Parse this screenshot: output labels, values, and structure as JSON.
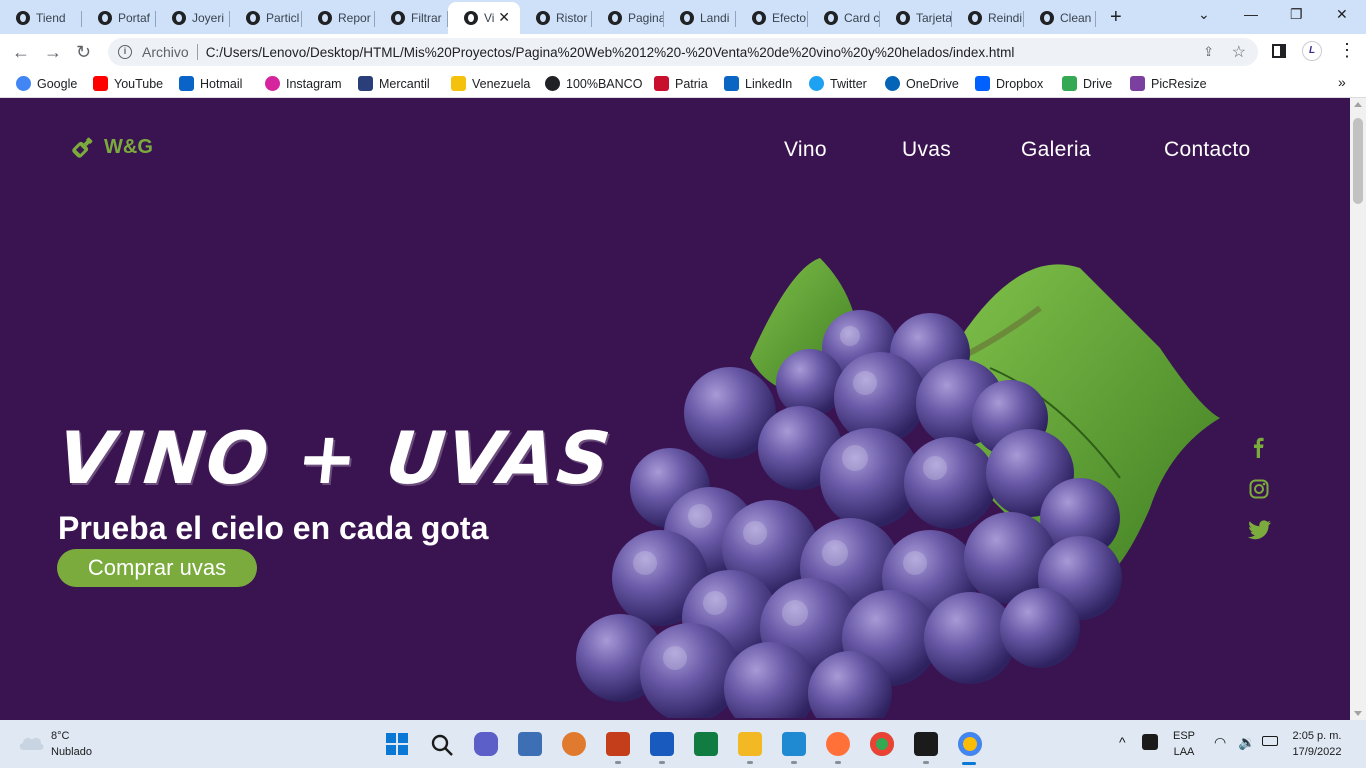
{
  "browser": {
    "tabs": [
      {
        "label": "Tiend"
      },
      {
        "label": "Portaf"
      },
      {
        "label": "Joyeri"
      },
      {
        "label": "Particl"
      },
      {
        "label": "Repor"
      },
      {
        "label": "Filtrar"
      },
      {
        "label": "Vi"
      },
      {
        "label": "Ristor"
      },
      {
        "label": "Pagina"
      },
      {
        "label": "Landi"
      },
      {
        "label": "Efecto"
      },
      {
        "label": "Card c"
      },
      {
        "label": "Tarjeta"
      },
      {
        "label": "Reindi"
      },
      {
        "label": "Clean"
      }
    ],
    "active_tab_index": 6,
    "address": {
      "scheme_label": "Archivo",
      "url": "C:/Users/Lenovo/Desktop/HTML/Mis%20Proyectos/Pagina%20Web%2012%20-%20Venta%20de%20vino%20y%20helados/index.html"
    },
    "bookmarks": [
      {
        "label": "Google",
        "color": "#4285f4"
      },
      {
        "label": "YouTube",
        "color": "#ff0000"
      },
      {
        "label": "Hotmail",
        "color": "#0a64c8"
      },
      {
        "label": "Instagram",
        "color": "#d6249f"
      },
      {
        "label": "Mercantil",
        "color": "#2a3f7a"
      },
      {
        "label": "Venezuela",
        "color": "#f4c20d"
      },
      {
        "label": "100%BANCO",
        "color": "#202124"
      },
      {
        "label": "Patria",
        "color": "#c8102e"
      },
      {
        "label": "LinkedIn",
        "color": "#0a66c2"
      },
      {
        "label": "Twitter",
        "color": "#1da1f2"
      },
      {
        "label": "OneDrive",
        "color": "#0364b8"
      },
      {
        "label": "Dropbox",
        "color": "#0061fe"
      },
      {
        "label": "Drive",
        "color": "#34a853"
      },
      {
        "label": "PicResize",
        "color": "#7b3fa0"
      }
    ]
  },
  "site": {
    "logo_text": "W&G",
    "nav": [
      "Vino",
      "Uvas",
      "Galeria",
      "Contacto"
    ],
    "hero_title": "Vino + Uvas",
    "hero_subtitle": "Prueba el cielo en cada gota",
    "cta_label": "Comprar uvas",
    "social_icons": [
      "facebook-icon",
      "instagram-icon",
      "twitter-icon"
    ],
    "colors": {
      "background": "#3a1351",
      "accent": "#7bab3c",
      "text": "#ffffff"
    }
  },
  "taskbar": {
    "weather_temp": "8°C",
    "weather_desc": "Nublado",
    "language_top": "ESP",
    "language_bottom": "LAA",
    "time": "2:05 p. m.",
    "date": "17/9/2022"
  }
}
